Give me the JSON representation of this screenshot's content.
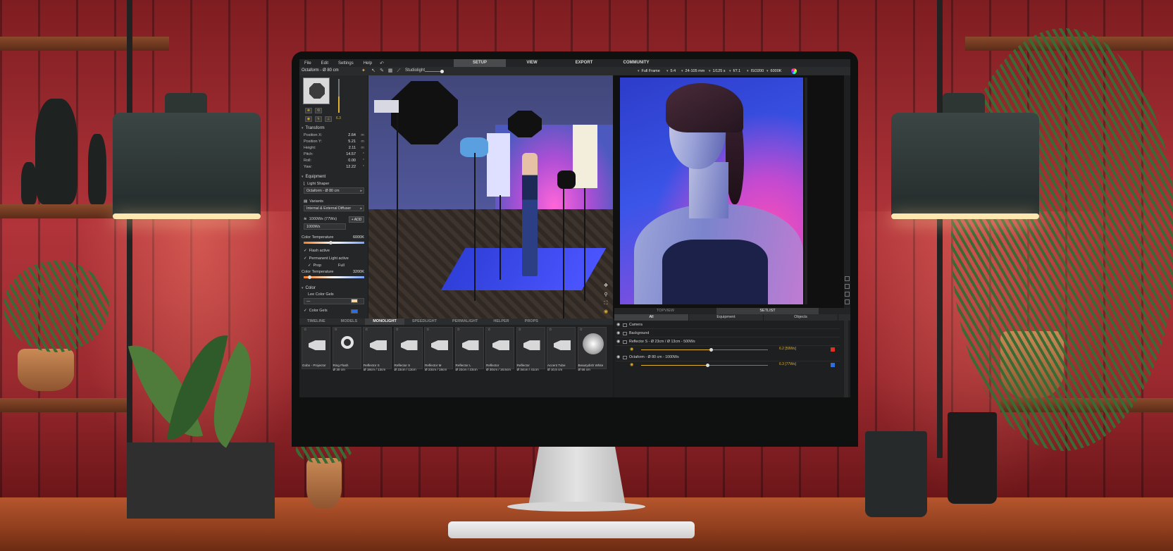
{
  "menu": {
    "items": [
      "File",
      "Edit",
      "Settings",
      "Help"
    ]
  },
  "main_tabs": [
    "SETUP",
    "VIEW",
    "EXPORT",
    "COMMUNITY"
  ],
  "toolbar": {
    "object_title": "Octaform - Ø 80 cm",
    "studiolight_label": "Studiolight"
  },
  "camera_settings": {
    "format": "Full Frame",
    "ratio": "5:4",
    "lens": "24-105 mm",
    "shutter": "1/125 s",
    "aperture": "f/7.1",
    "iso": "ISO200",
    "wb": "6000K"
  },
  "left_panel": {
    "power_value": "6.3",
    "transform": {
      "header": "Transform",
      "rows": [
        {
          "label": "Position X:",
          "value": "2.64",
          "unit": "m"
        },
        {
          "label": "Position Y:",
          "value": "5.21",
          "unit": "m"
        },
        {
          "label": "Height:",
          "value": "2.11",
          "unit": "m"
        },
        {
          "label": "Pitch:",
          "value": "14.57",
          "unit": "°"
        },
        {
          "label": "Roll:",
          "value": "0.00",
          "unit": "°"
        },
        {
          "label": "Yaw:",
          "value": "12.22",
          "unit": "°"
        }
      ]
    },
    "equipment_header": "Equipment",
    "light_shaper_label": "Light Shaper",
    "light_shaper_value": "Octaform - Ø 80 cm",
    "variants_label": "Variants",
    "variants_value": "Internal & External Diffuser",
    "flash_label": "1000Ws (77Ws)",
    "add_label": "+ ADD",
    "flash_value": "1000Ws",
    "color_temp_label": "Color Temperature",
    "color_temp_value": "6000K",
    "flash_active": "Flash active",
    "permanent_light": "Permanent Light active",
    "prop_label": "Prop",
    "prop_value": "Full",
    "color_temp2_label": "Color Temperature",
    "color_temp2_value": "3200K",
    "color_header": "Color",
    "lee_gels": "Lee Color Gels",
    "lee_gels_value": "—",
    "color_gels": "Color Gels"
  },
  "library": {
    "tabs": [
      "TIMELINE",
      "MODELS",
      "MONOLIGHT",
      "SPEEDLIGHT",
      "PERMALIGHT",
      "HELPER",
      "PROPS"
    ],
    "active_tab": "MONOLIGHT",
    "items": [
      {
        "line1": "Gobo - Projector",
        "line2": ""
      },
      {
        "line1": "Ring Flash",
        "line2": "Ø 30 cm"
      },
      {
        "line1": "Reflector S",
        "line2": "Ø 18cm / 13cm"
      },
      {
        "line1": "Reflector S",
        "line2": "Ø 23cm / 13cm"
      },
      {
        "line1": "Reflector M",
        "line2": "Ø 23cm / 18cm"
      },
      {
        "line1": "Reflector L",
        "line2": "Ø 23cm / 23cm"
      },
      {
        "line1": "Reflector",
        "line2": "Ø 30cm / 16.5cm"
      },
      {
        "line1": "Reflector",
        "line2": "Ø 34cm / 41cm"
      },
      {
        "line1": "Accent Tube",
        "line2": "Ø 10,5 cm"
      },
      {
        "line1": "Beautydish White",
        "line2": "Ø 56 cm"
      }
    ]
  },
  "scene_list": {
    "tabs": [
      "TOPVIEW",
      "SETLIST"
    ],
    "filters": [
      "All",
      "Equipment",
      "Objects"
    ],
    "rows": [
      {
        "name": "Camera"
      },
      {
        "name": "Background"
      },
      {
        "name": "Reflector S - Ø 23cm / Ø 13cm - 500Ws",
        "power": "6.2 [59Ws]",
        "level": 0.55,
        "color": "#e0301e"
      },
      {
        "name": "Octaform - Ø 80 cm - 1000Ws",
        "power": "6.3 [77Ws]",
        "level": 0.52,
        "color": "#2e6fe0"
      }
    ]
  },
  "colors": {
    "accent": "#e0b030",
    "active_tab": "#4a4b4d"
  }
}
